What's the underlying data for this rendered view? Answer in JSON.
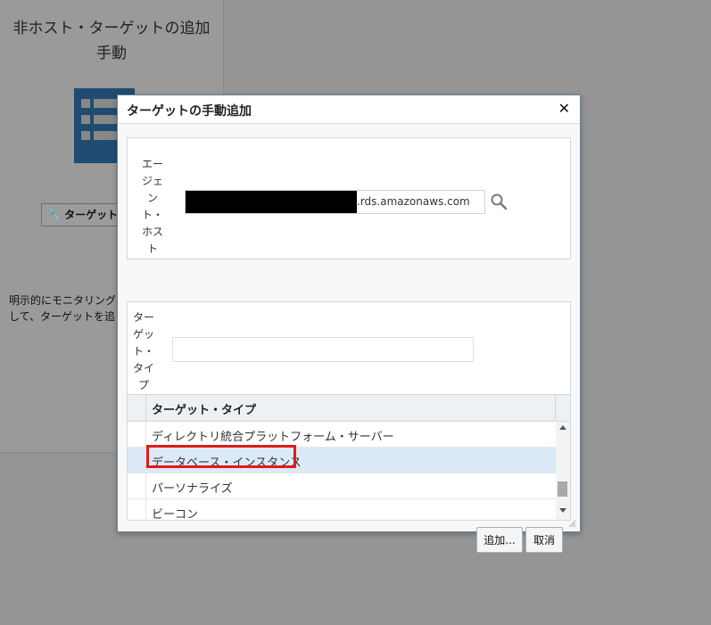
{
  "background": {
    "title_line1": "非ホスト・ターゲットの追加",
    "title_line2": "手動",
    "button_label": "ターゲット",
    "description_line1": "明示的にモニタリング",
    "description_line2": "して、ターゲットを追"
  },
  "dialog": {
    "title": "ターゲットの手動追加",
    "close_glyph": "✕",
    "agent_host": {
      "label_lines": [
        "エー",
        "ジェ",
        "ン",
        "ト・",
        "ホス",
        "ト"
      ],
      "value_suffix": ".rds.amazonaws.com",
      "search_icon": "magnifier-icon"
    },
    "target_type": {
      "label_lines": [
        "ター",
        "ゲッ",
        "ト・",
        "タイ",
        "プ"
      ],
      "input_value": ""
    },
    "table": {
      "column_header": "ターゲット・タイプ",
      "rows": [
        {
          "label": "ディレクトリ統合プラットフォーム・サーバー"
        },
        {
          "label": "データベース・インスタンス"
        },
        {
          "label": "パーソナライズ"
        },
        {
          "label": "ビーコン"
        }
      ],
      "selected_index": 1
    },
    "buttons": {
      "add_label": "追加...",
      "cancel_label": "取消"
    }
  },
  "colors": {
    "overlay": "#959595",
    "highlight": "#e01b1b",
    "selected_row": "#dceaf7",
    "icon_blue": "#1f4c70"
  }
}
